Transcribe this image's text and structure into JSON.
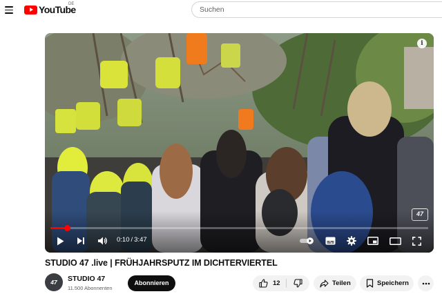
{
  "header": {
    "logo_text": "YouTube",
    "country_code": "DE",
    "search_placeholder": "Suchen"
  },
  "player": {
    "current_time": "0:10",
    "time_separator": "/",
    "duration": "3:47",
    "progress": 0.044,
    "watermark": "47",
    "info_glyph": "i",
    "icons": [
      "play-icon",
      "next-icon",
      "volume-icon",
      "autoplay-toggle",
      "subtitles-icon",
      "settings-gear-icon",
      "miniplayer-icon",
      "theater-mode-icon",
      "fullscreen-icon"
    ]
  },
  "video": {
    "title": "STUDIO 47 .live | FRÜHJAHRSPUTZ IM DICHTERVIERTEL"
  },
  "channel": {
    "avatar_text": "47",
    "name": "STUDIO 47",
    "subscribers": "11.500 Abonnenten",
    "subscribe_label": "Abonnieren"
  },
  "actions": {
    "like_count": "12",
    "share_label": "Teilen",
    "save_label": "Speichern"
  },
  "colors": {
    "accent": "#ff0000",
    "button_dark": "#0f0f0f",
    "pill_bg": "#f2f2f2"
  }
}
